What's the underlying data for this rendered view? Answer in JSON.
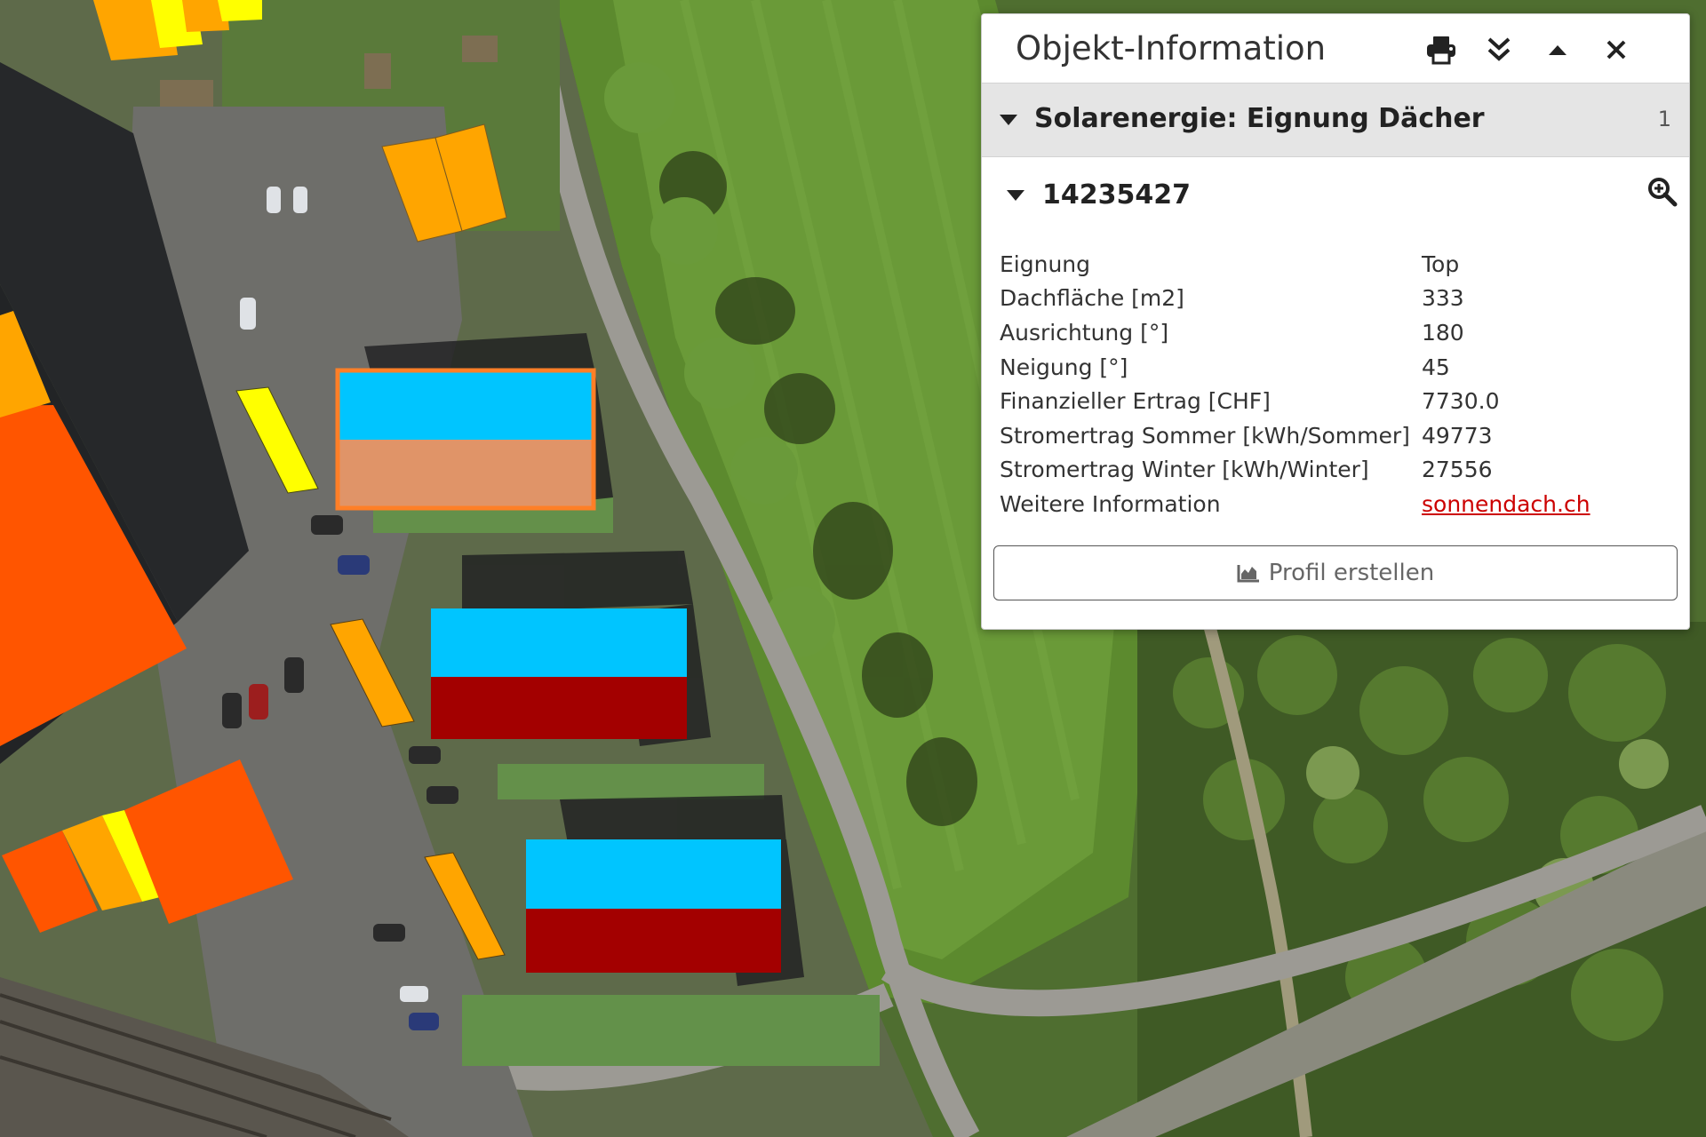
{
  "panel": {
    "title": "Objekt-Information",
    "header_buttons": [
      "print-icon",
      "double-chevron-down-icon",
      "caret-up-icon",
      "close-icon"
    ],
    "layer": {
      "title": "Solarenergie: Eignung Dächer",
      "count": "1"
    },
    "feature": {
      "id": "14235427",
      "attributes": [
        {
          "key": "Eignung",
          "value": "Top"
        },
        {
          "key": "Dachfläche [m2]",
          "value": "333"
        },
        {
          "key": "Ausrichtung [°]",
          "value": "180"
        },
        {
          "key": "Neigung [°]",
          "value": "45"
        },
        {
          "key": "Finanzieller Ertrag [CHF]",
          "value": "7730.0"
        },
        {
          "key": "Stromertrag Sommer [kWh/Sommer]",
          "value": "49773"
        },
        {
          "key": "Stromertrag Winter [kWh/Winter]",
          "value": "27556"
        },
        {
          "key": "Weitere Information",
          "value": "sonnendach.ch"
        }
      ]
    },
    "profile_button": "Profil erstellen"
  },
  "roof_colors": {
    "top": "#a30000",
    "sehr_gut": "#ff5500",
    "gut": "#ffa500",
    "mittel": "#ffff00",
    "gering": "#00c5ff",
    "selected_outline": "#ff7f27",
    "selected_fill": "#e09468"
  }
}
